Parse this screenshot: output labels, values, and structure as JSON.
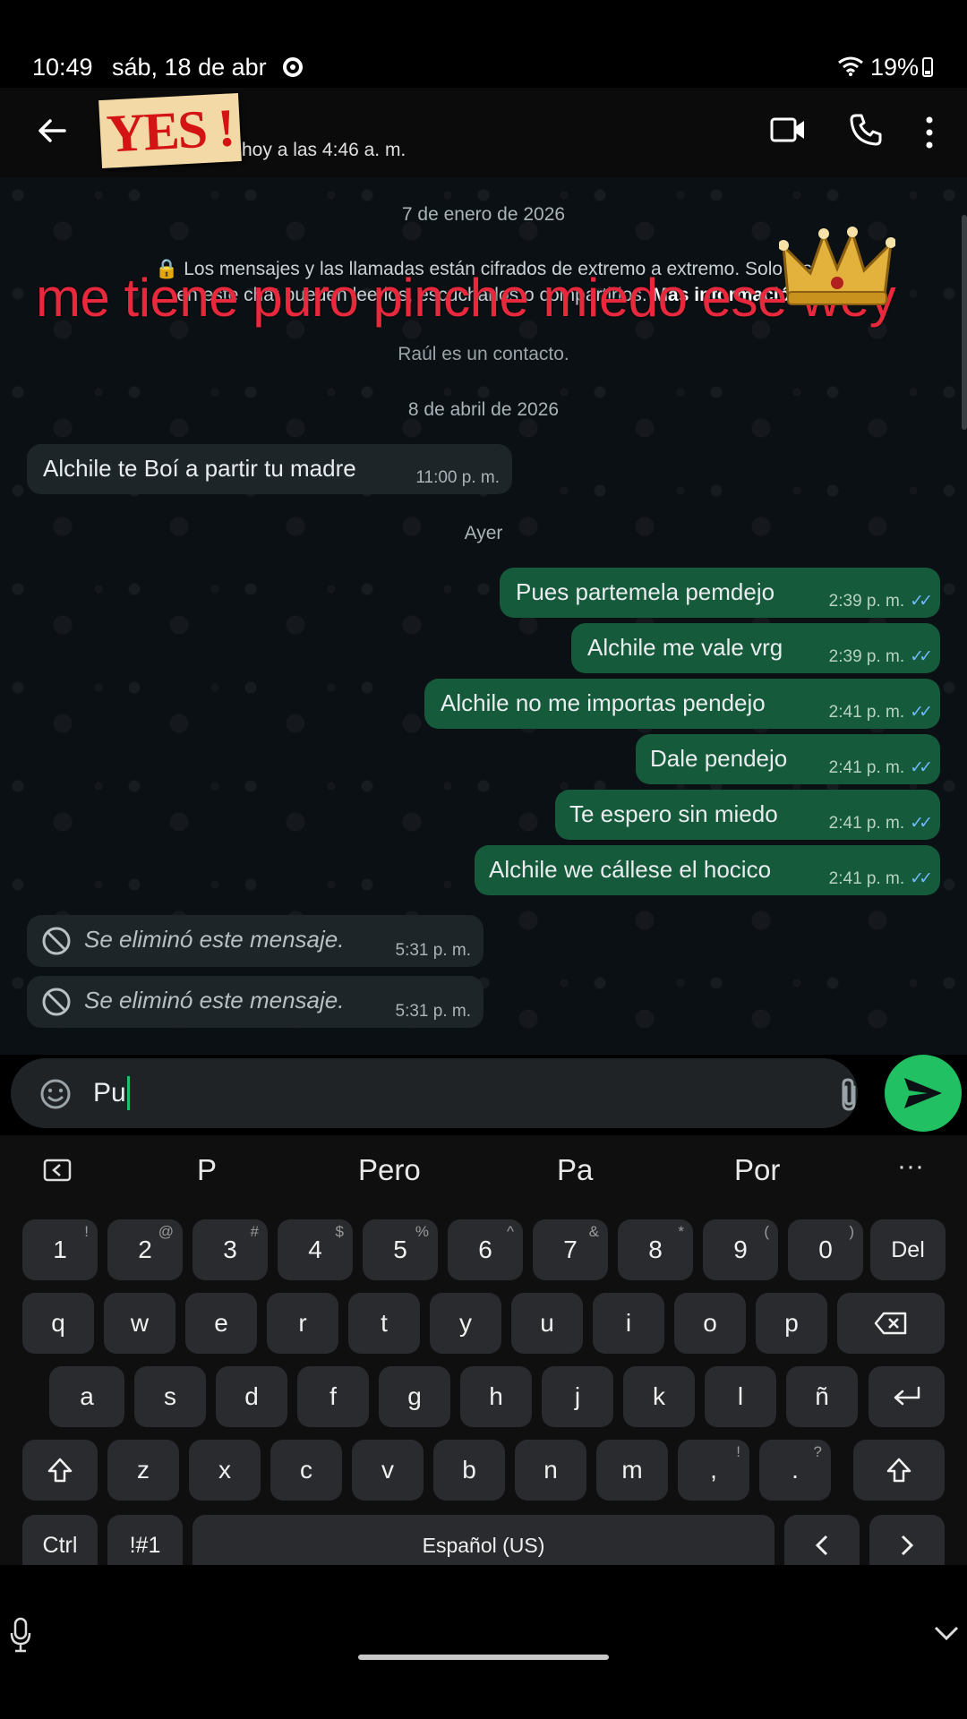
{
  "status_bar": {
    "time": "10:49",
    "date": "sáb, 18 de abr",
    "battery": "19%"
  },
  "header": {
    "sticker_text": "YES !",
    "last_seen": "hoy a las 4:46 a. m.",
    "icons": [
      "back-arrow-icon",
      "video-call-icon",
      "phone-call-icon",
      "more-options-icon"
    ]
  },
  "chat": {
    "date_1": "7 de enero de 2026",
    "encryption_notice_line1": "Los mensajes y las llamadas están cifrados de extremo a extremo. Solo las",
    "encryption_notice_line2": "en este chat pueden leerlos, escucharlos o compartirlos.",
    "encryption_more": "Más informació",
    "overlay_caption": "me tiene puro pinche miedo ese wey",
    "contact_note": "Raúl es un contacto.",
    "date_2": "8 de abril de 2026",
    "date_3": "Ayer",
    "messages": [
      {
        "dir": "in",
        "text": "Alchile te Boí a partir tu madre",
        "time": "11:00 p. m."
      },
      {
        "dir": "out",
        "text": "Pues partemela pemdejo",
        "time": "2:39 p. m."
      },
      {
        "dir": "out",
        "text": "Alchile me vale vrg",
        "time": "2:39 p. m."
      },
      {
        "dir": "out",
        "text": "Alchile no me importas pendejo",
        "time": "2:41 p. m."
      },
      {
        "dir": "out",
        "text": "Dale pendejo",
        "time": "2:41 p. m."
      },
      {
        "dir": "out",
        "text": "Te espero sin miedo",
        "time": "2:41 p. m."
      },
      {
        "dir": "out",
        "text": "Alchile we cállese el hocico",
        "time": "2:41 p. m."
      },
      {
        "dir": "in",
        "deleted": true,
        "text": "Se eliminó este mensaje.",
        "time": "5:31 p. m."
      },
      {
        "dir": "in",
        "deleted": true,
        "text": "Se eliminó este mensaje.",
        "time": "5:31 p. m."
      }
    ]
  },
  "composer": {
    "value": "Pu"
  },
  "suggestions": [
    "P",
    "Pero",
    "Pa",
    "Por"
  ],
  "keyboard": {
    "row_numbers": [
      {
        "k": "1",
        "s": "!"
      },
      {
        "k": "2",
        "s": "@"
      },
      {
        "k": "3",
        "s": "#"
      },
      {
        "k": "4",
        "s": "$"
      },
      {
        "k": "5",
        "s": "%"
      },
      {
        "k": "6",
        "s": "^"
      },
      {
        "k": "7",
        "s": "&"
      },
      {
        "k": "8",
        "s": "*"
      },
      {
        "k": "9",
        "s": "("
      },
      {
        "k": "0",
        "s": ")"
      }
    ],
    "del": "Del",
    "row_q": [
      "q",
      "w",
      "e",
      "r",
      "t",
      "y",
      "u",
      "i",
      "o",
      "p"
    ],
    "row_a": [
      "a",
      "s",
      "d",
      "f",
      "g",
      "h",
      "j",
      "k",
      "l",
      "ñ"
    ],
    "row_z": [
      "z",
      "x",
      "c",
      "v",
      "b",
      "n",
      "m"
    ],
    "comma": ",",
    "comma_sup": "!",
    "period": ".",
    "period_sup": "?",
    "ctrl": "Ctrl",
    "symbols": "!#1",
    "space": "Español (US)"
  },
  "colors": {
    "accent_green": "#21c063",
    "outgoing_bubble": "#155a3a",
    "incoming_bubble": "#1e2529",
    "read_ticks": "#6fb8ff",
    "overlay_red": "#e8283c"
  }
}
